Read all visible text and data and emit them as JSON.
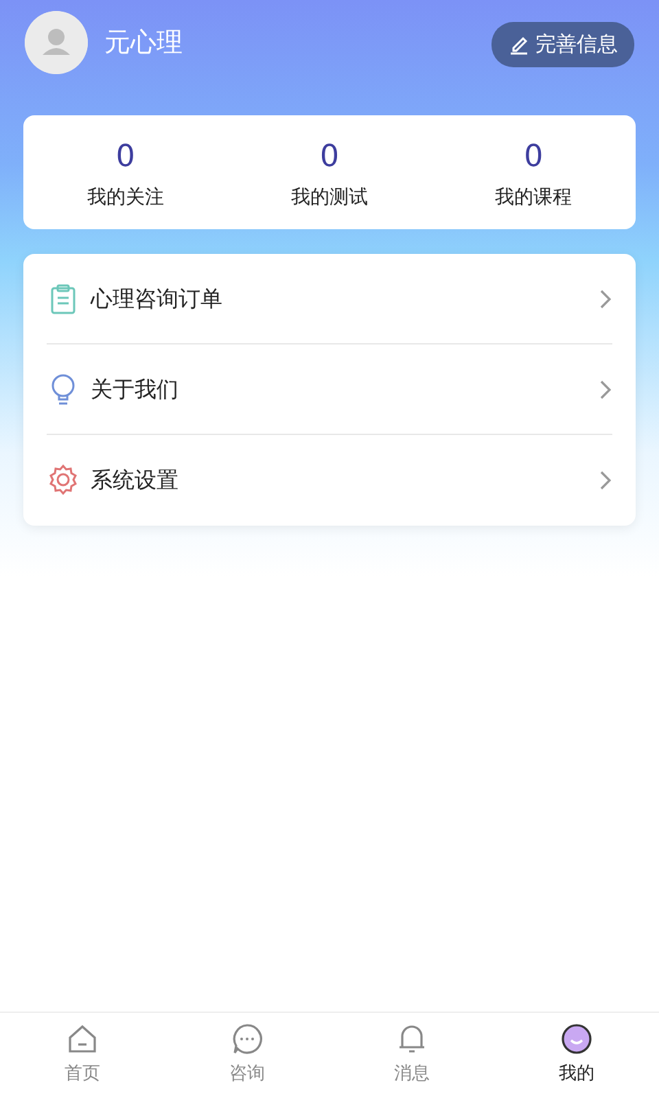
{
  "profile": {
    "name": "元心理",
    "edit_button": "完善信息"
  },
  "stats": [
    {
      "value": "0",
      "label": "我的关注"
    },
    {
      "value": "0",
      "label": "我的测试"
    },
    {
      "value": "0",
      "label": "我的课程"
    }
  ],
  "menu": [
    {
      "label": "心理咨询订单"
    },
    {
      "label": "关于我们"
    },
    {
      "label": "系统设置"
    }
  ],
  "tabs": [
    {
      "label": "首页",
      "selected": false
    },
    {
      "label": "咨询",
      "selected": false
    },
    {
      "label": "消息",
      "selected": false
    },
    {
      "label": "我的",
      "selected": true
    }
  ]
}
